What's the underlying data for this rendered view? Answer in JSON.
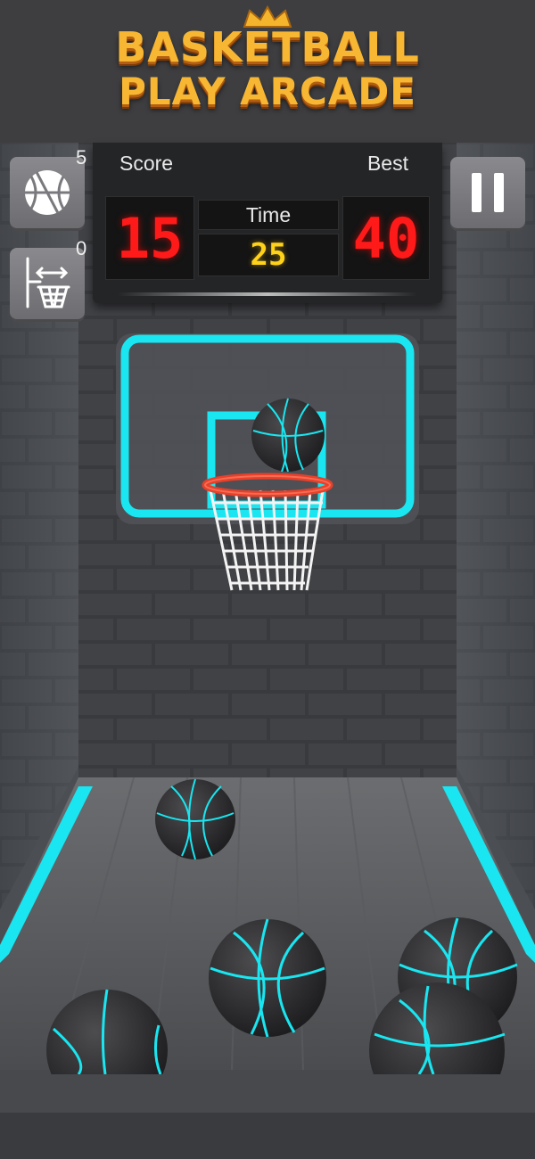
{
  "title": {
    "line1": "BASKETBALL",
    "line2": "PLAY ARCADE"
  },
  "scoreboard": {
    "score_label": "Score",
    "best_label": "Best",
    "time_label": "Time",
    "score": "15",
    "best": "40",
    "time": "25"
  },
  "powerups": {
    "ball_count": "5",
    "hoop_count": "0"
  },
  "icons": {
    "ball_powerup": "basketball-icon",
    "hoop_powerup": "moving-hoop-icon",
    "pause": "pause-icon",
    "crown": "crown-icon"
  },
  "colors": {
    "neon": "#19e6f0",
    "score_digits": "#ff1a1a",
    "time_digits": "#ffd21a",
    "title_gold": "#f7b733",
    "rim": "#e8402a"
  }
}
